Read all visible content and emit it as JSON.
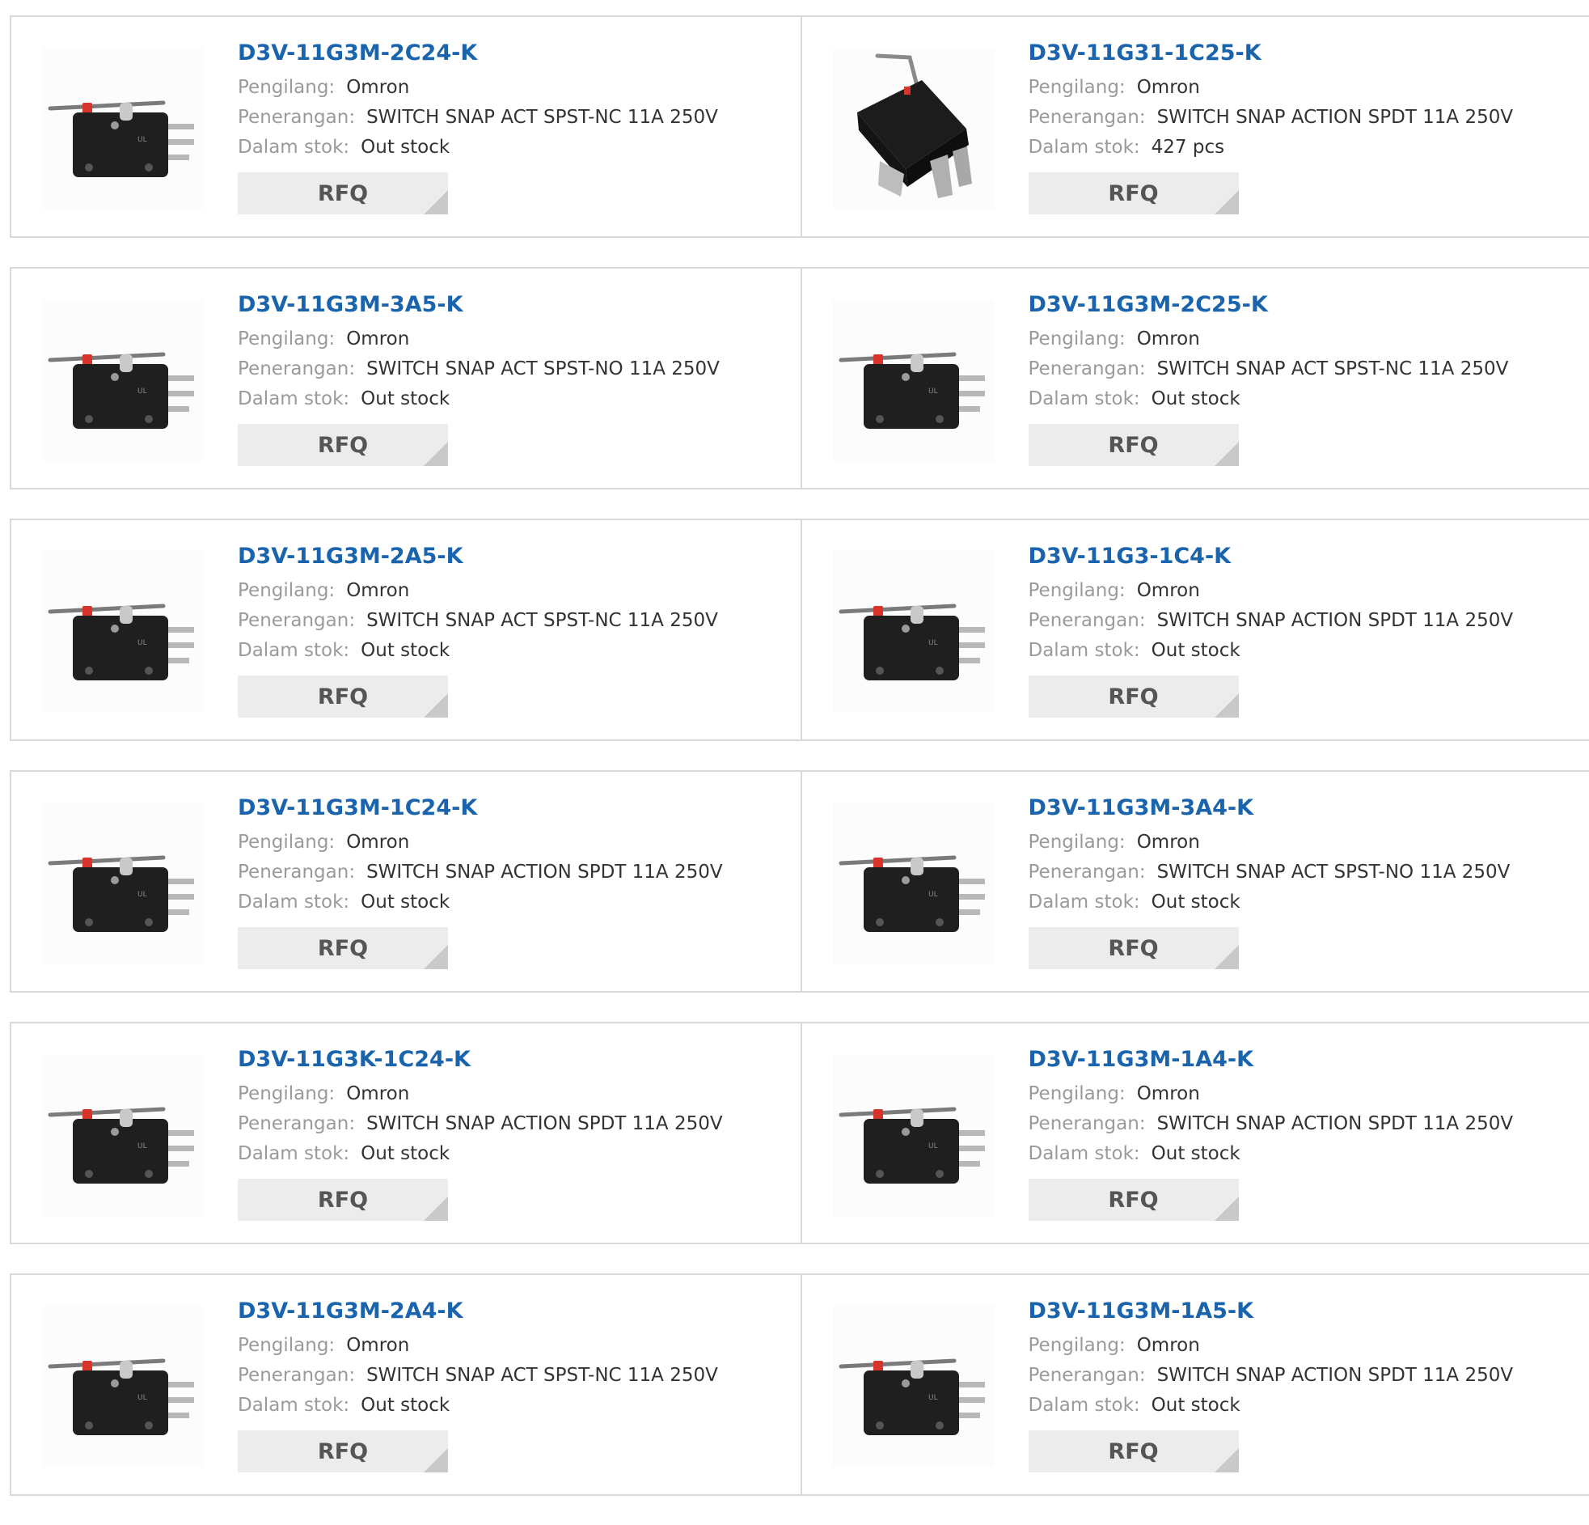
{
  "labels": {
    "manufacturer": "Pengilang:",
    "description": "Penerangan:",
    "stock": "Dalam stok:",
    "rfq": "RFQ"
  },
  "products": [
    {
      "part": "D3V-11G3M-2C24-K",
      "manufacturer": "Omron",
      "description": "SWITCH SNAP ACT SPST-NC 11A 250V",
      "stock": "Out stock",
      "image": "lever-switch-side"
    },
    {
      "part": "D3V-11G31-1C25-K",
      "manufacturer": "Omron",
      "description": "SWITCH SNAP ACTION SPDT 11A 250V",
      "stock": "427 pcs",
      "image": "lever-switch-angled"
    },
    {
      "part": "D3V-11G3M-3A5-K",
      "manufacturer": "Omron",
      "description": "SWITCH SNAP ACT SPST-NO 11A 250V",
      "stock": "Out stock",
      "image": "lever-switch-side"
    },
    {
      "part": "D3V-11G3M-2C25-K",
      "manufacturer": "Omron",
      "description": "SWITCH SNAP ACT SPST-NC 11A 250V",
      "stock": "Out stock",
      "image": "lever-switch-side"
    },
    {
      "part": "D3V-11G3M-2A5-K",
      "manufacturer": "Omron",
      "description": "SWITCH SNAP ACT SPST-NC 11A 250V",
      "stock": "Out stock",
      "image": "lever-switch-side"
    },
    {
      "part": "D3V-11G3-1C4-K",
      "manufacturer": "Omron",
      "description": "SWITCH SNAP ACTION SPDT 11A 250V",
      "stock": "Out stock",
      "image": "lever-switch-side"
    },
    {
      "part": "D3V-11G3M-1C24-K",
      "manufacturer": "Omron",
      "description": "SWITCH SNAP ACTION SPDT 11A 250V",
      "stock": "Out stock",
      "image": "lever-switch-side"
    },
    {
      "part": "D3V-11G3M-3A4-K",
      "manufacturer": "Omron",
      "description": "SWITCH SNAP ACT SPST-NO 11A 250V",
      "stock": "Out stock",
      "image": "lever-switch-side"
    },
    {
      "part": "D3V-11G3K-1C24-K",
      "manufacturer": "Omron",
      "description": "SWITCH SNAP ACTION SPDT 11A 250V",
      "stock": "Out stock",
      "image": "lever-switch-side"
    },
    {
      "part": "D3V-11G3M-1A4-K",
      "manufacturer": "Omron",
      "description": "SWITCH SNAP ACTION SPDT 11A 250V",
      "stock": "Out stock",
      "image": "lever-switch-side"
    },
    {
      "part": "D3V-11G3M-2A4-K",
      "manufacturer": "Omron",
      "description": "SWITCH SNAP ACT SPST-NC 11A 250V",
      "stock": "Out stock",
      "image": "lever-switch-side"
    },
    {
      "part": "D3V-11G3M-1A5-K",
      "manufacturer": "Omron",
      "description": "SWITCH SNAP ACTION SPDT 11A 250V",
      "stock": "Out stock",
      "image": "lever-switch-side"
    }
  ],
  "colors": {
    "part_link": "#1a64ad",
    "label": "#9a9a9a",
    "value": "#333333",
    "rfq_bg": "#ececec",
    "border": "#d9d9d9"
  }
}
